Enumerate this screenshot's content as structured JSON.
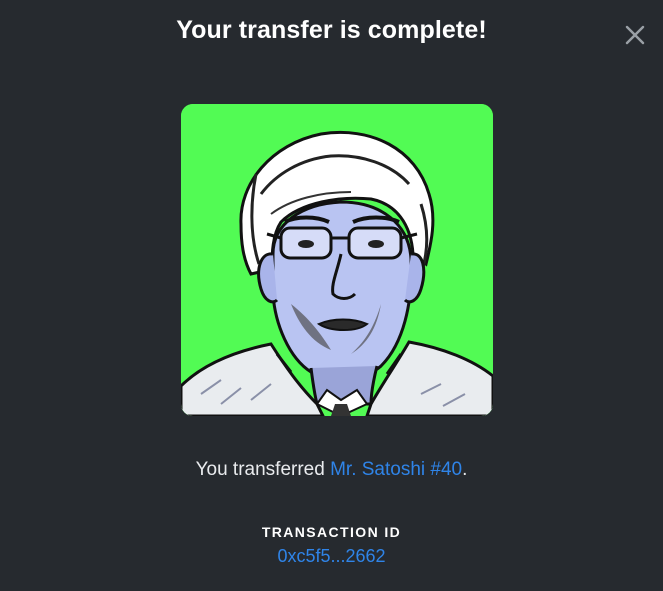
{
  "modal": {
    "title": "Your transfer is complete!",
    "close_icon": "close-icon",
    "image": {
      "description_icon": "nft-portrait-image",
      "background_color": "#52fb54"
    },
    "message": {
      "prefix": "You transferred ",
      "item_name": "Mr. Satoshi #40",
      "suffix": "."
    },
    "transaction": {
      "label": "TRANSACTION ID",
      "id": "0xc5f5...2662"
    }
  },
  "colors": {
    "background": "#262a2f",
    "link": "#2f84e8",
    "text": "#ffffff"
  }
}
